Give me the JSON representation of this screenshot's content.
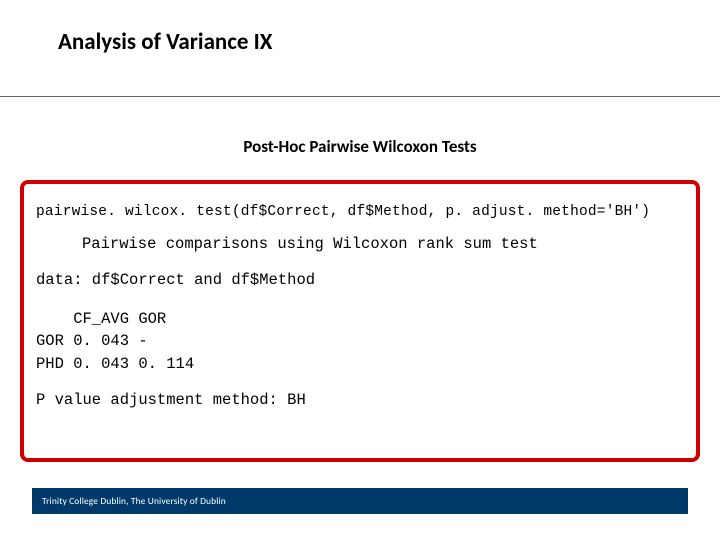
{
  "title": "Analysis of Variance IX",
  "subtitle": "Post-Hoc Pairwise Wilcoxon Tests",
  "code": {
    "call": "pairwise. wilcox. test(df$Correct, df$Method, p. adjust. method='BH')",
    "desc": "Pairwise comparisons using Wilcoxon rank sum test",
    "data_line": "data:  df$Correct and df$Method",
    "table": "    CF_AVG GOR  \nGOR 0. 043 -    \nPHD 0. 043 0. 114",
    "pval_line": "P value adjustment method: BH"
  },
  "footer": "Trinity College Dublin, The University of Dublin"
}
